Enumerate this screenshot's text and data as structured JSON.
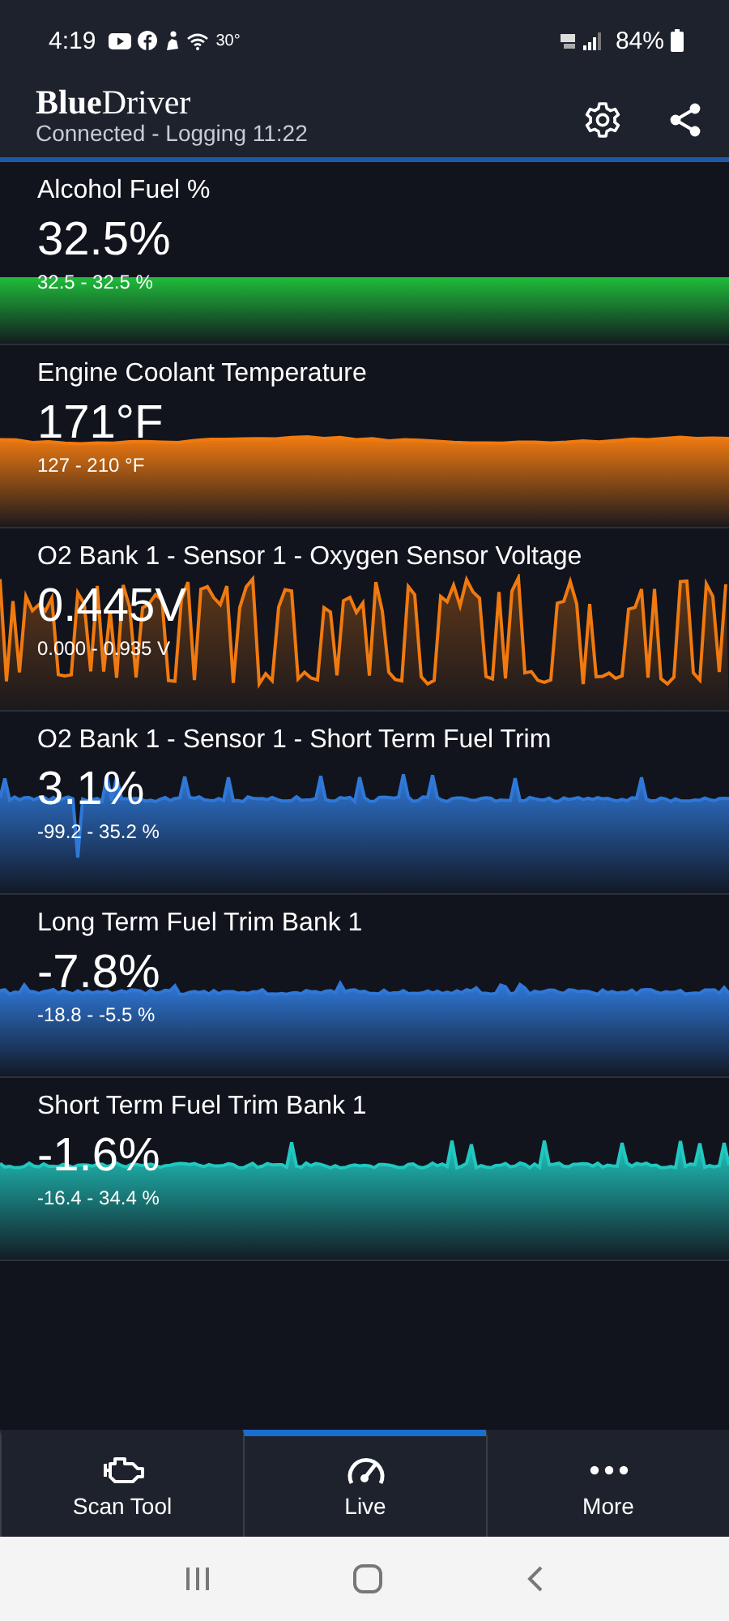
{
  "status_bar": {
    "time": "4:19",
    "temperature": "30°",
    "battery": "84%"
  },
  "header": {
    "logo": "**Blue**Driver",
    "subtitle": "Connected - Logging 11:22"
  },
  "gauges": [
    {
      "name": "Alcohol Fuel %",
      "value": "32.5%",
      "range": "32.5 - 32.5 %",
      "color": "#1fb83a",
      "kind": "flat"
    },
    {
      "name": "Engine Coolant Temperature",
      "value": "171°F",
      "range": "127 - 210 °F",
      "color": "#f07a10",
      "kind": "smooth"
    },
    {
      "name": "O2 Bank 1 - Sensor 1 - Oxygen Sensor Voltage",
      "value": "0.445V",
      "range": "0.000 - 0.935 V",
      "color": "#f07a10",
      "kind": "square"
    },
    {
      "name": "O2 Bank 1 - Sensor 1 - Short Term Fuel Trim",
      "value": "3.1%",
      "range": "-99.2 - 35.2 %",
      "color": "#2f78d8",
      "kind": "spiky"
    },
    {
      "name": "Long Term Fuel Trim Bank 1",
      "value": "-7.8%",
      "range": "-18.8 - -5.5 %",
      "color": "#2f78d8",
      "kind": "steady"
    },
    {
      "name": "Short Term Fuel Trim Bank 1",
      "value": "-1.6%",
      "range": "-16.4 - 34.4 %",
      "color": "#20c8c0",
      "kind": "spiky"
    }
  ],
  "tabs": [
    {
      "label": "Scan Tool",
      "selected": false,
      "kind": "engine"
    },
    {
      "label": "Live",
      "selected": true,
      "kind": "gauge"
    },
    {
      "label": "More",
      "selected": false,
      "kind": "dots"
    }
  ]
}
